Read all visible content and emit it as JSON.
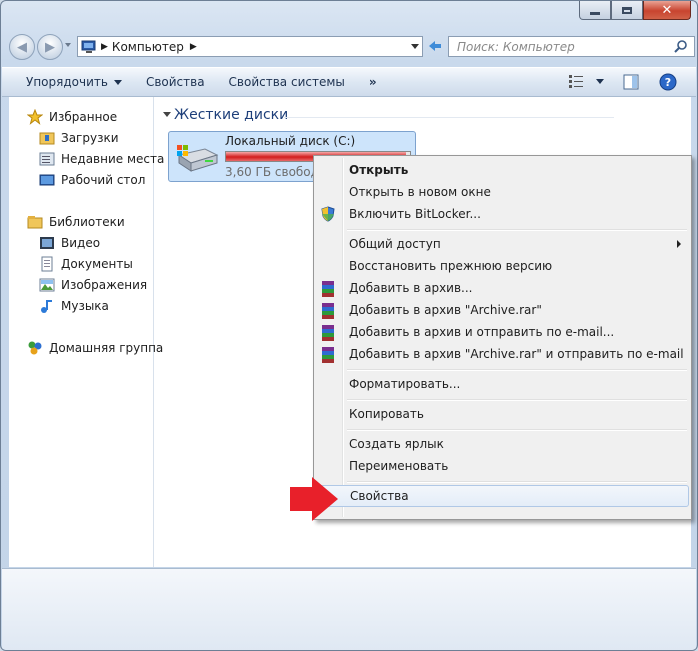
{
  "window": {
    "close_glyph": "✕"
  },
  "nav": {
    "back_icon": "arrow-left",
    "forward_icon": "arrow-right",
    "address": "Компьютер",
    "search_placeholder": "Поиск: Компьютер"
  },
  "toolbar": {
    "organize": "Упорядочить",
    "properties": "Свойства",
    "system_properties": "Свойства системы",
    "more": "»"
  },
  "sidebar": {
    "favorites": {
      "title": "Избранное",
      "items": [
        "Загрузки",
        "Недавние места",
        "Рабочий стол"
      ]
    },
    "libraries": {
      "title": "Библиотеки",
      "items": [
        "Видео",
        "Документы",
        "Изображения",
        "Музыка"
      ]
    },
    "homegroup": "Домашняя группа"
  },
  "main": {
    "group_title": "Жесткие диски",
    "drive": {
      "name": "Локальный диск (C:)",
      "free": "3,60 ГБ свободно",
      "used_fraction": 0.98,
      "bar_color": "#d21d1d"
    }
  },
  "context_menu": {
    "open": "Открыть",
    "open_new_window": "Открыть в новом окне",
    "bitlocker": "Включить BitLocker...",
    "share": "Общий доступ",
    "restore": "Восстановить прежнюю версию",
    "add_archive": "Добавить в архив...",
    "add_archive_rar": "Добавить в архив \"Archive.rar\"",
    "add_archive_email": "Добавить в архив и отправить по e-mail...",
    "add_archive_rar_email": "Добавить в архив \"Archive.rar\" и отправить по e-mail",
    "format": "Форматировать...",
    "copy": "Копировать",
    "create_shortcut": "Создать ярлык",
    "rename": "Переименовать",
    "properties": "Свойства"
  },
  "colors": {
    "pointer_arrow": "#e8202a",
    "group_title": "#1e3f7a",
    "selection": "#cde4fb"
  }
}
